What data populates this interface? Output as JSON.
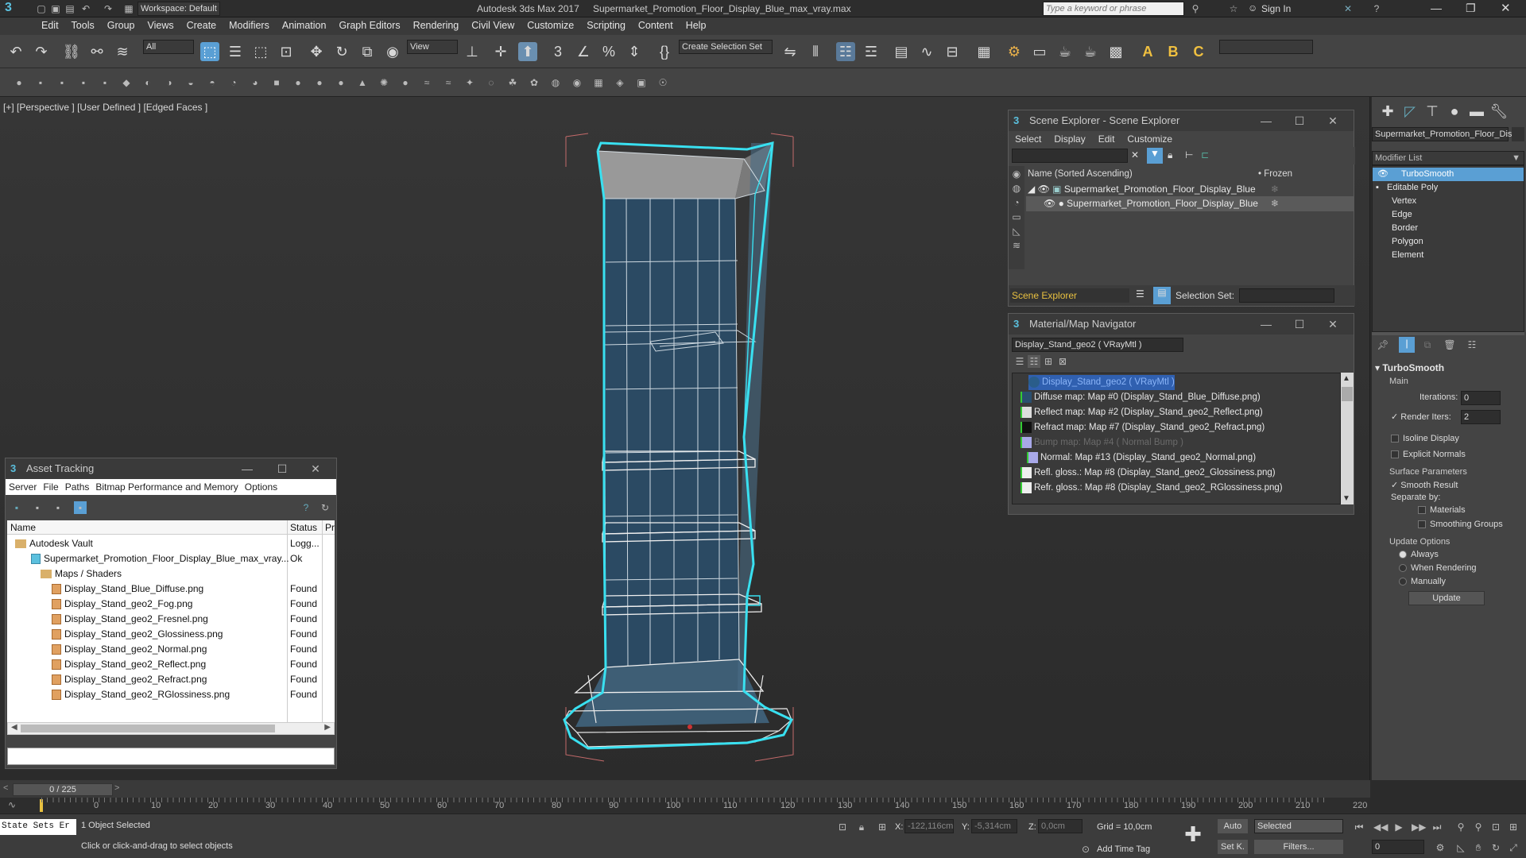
{
  "title_bar": {
    "workspace": "Workspace: Default",
    "app_title": "Autodesk 3ds Max 2017",
    "file_name": "Supermarket_Promotion_Floor_Display_Blue_max_vray.max",
    "search_placeholder": "Type a keyword or phrase",
    "sign_in": "Sign In"
  },
  "menu": [
    "Edit",
    "Tools",
    "Group",
    "Views",
    "Create",
    "Modifiers",
    "Animation",
    "Graph Editors",
    "Rendering",
    "Civil View",
    "Customize",
    "Scripting",
    "Content",
    "Help"
  ],
  "toolbar": {
    "filter": "All",
    "ref_coord": "View",
    "selection_set": "Create Selection Set"
  },
  "viewport": {
    "label_plus": "[+]",
    "label_view": "[Perspective ]",
    "label_shading": "[User Defined ]",
    "label_edges": "[Edged Faces ]"
  },
  "scene_explorer": {
    "title": "Scene Explorer - Scene Explorer",
    "menu": [
      "Select",
      "Display",
      "Edit",
      "Customize"
    ],
    "col_name": "Name (Sorted Ascending)",
    "col_frozen": "Frozen",
    "rows": [
      "Supermarket_Promotion_Floor_Display_Blue",
      "Supermarket_Promotion_Floor_Display_Blue"
    ],
    "footer_name": "Scene Explorer",
    "selection_set_label": "Selection Set:"
  },
  "material_nav": {
    "title": "Material/Map Navigator",
    "material": "Display_Stand_geo2  ( VRayMtl )",
    "items": [
      "Display_Stand_geo2  ( VRayMtl )",
      "Diffuse map: Map #0 (Display_Stand_Blue_Diffuse.png)",
      "Reflect map: Map #2 (Display_Stand_geo2_Reflect.png)",
      "Refract map: Map #7 (Display_Stand_geo2_Refract.png)",
      "Bump map: Map #4  ( Normal Bump )",
      "Normal: Map #13 (Display_Stand_geo2_Normal.png)",
      "Refl. gloss.: Map #8 (Display_Stand_geo2_Glossiness.png)",
      "Refr. gloss.: Map #8 (Display_Stand_geo2_RGlossiness.png)"
    ]
  },
  "asset_tracking": {
    "title": "Asset Tracking",
    "menu": [
      "Server",
      "File",
      "Paths",
      "Bitmap Performance and Memory",
      "Options"
    ],
    "col_name": "Name",
    "col_status": "Status",
    "col_pr": "Pr",
    "rows": [
      {
        "name": "Autodesk Vault",
        "status": "Logg..."
      },
      {
        "name": "Supermarket_Promotion_Floor_Display_Blue_max_vray...",
        "status": "Ok"
      },
      {
        "name": "Maps / Shaders",
        "status": ""
      },
      {
        "name": "Display_Stand_Blue_Diffuse.png",
        "status": "Found"
      },
      {
        "name": "Display_Stand_geo2_Fog.png",
        "status": "Found"
      },
      {
        "name": "Display_Stand_geo2_Fresnel.png",
        "status": "Found"
      },
      {
        "name": "Display_Stand_geo2_Glossiness.png",
        "status": "Found"
      },
      {
        "name": "Display_Stand_geo2_Normal.png",
        "status": "Found"
      },
      {
        "name": "Display_Stand_geo2_Reflect.png",
        "status": "Found"
      },
      {
        "name": "Display_Stand_geo2_Refract.png",
        "status": "Found"
      },
      {
        "name": "Display_Stand_geo2_RGlossiness.png",
        "status": "Found"
      }
    ]
  },
  "command_panel": {
    "object_name": "Supermarket_Promotion_Floor_Disp",
    "modifier_list": "Modifier List",
    "stack": [
      "TurboSmooth",
      "Editable Poly",
      "Vertex",
      "Edge",
      "Border",
      "Polygon",
      "Element"
    ],
    "rollout_title": "TurboSmooth",
    "main_label": "Main",
    "iterations_label": "Iterations:",
    "iterations_value": "0",
    "render_iters_label": "Render Iters:",
    "render_iters_value": "2",
    "isoline": "Isoline Display",
    "explicit_normals": "Explicit Normals",
    "surface_params": "Surface Parameters",
    "smooth_result": "Smooth Result",
    "separate_by": "Separate by:",
    "materials": "Materials",
    "smoothing_groups": "Smoothing Groups",
    "update_options": "Update Options",
    "always": "Always",
    "when_rendering": "When Rendering",
    "manually": "Manually",
    "update_btn": "Update"
  },
  "timeline": {
    "frame_counter": "0 / 225",
    "ticks": [
      "0",
      "10",
      "20",
      "30",
      "40",
      "50",
      "60",
      "70",
      "80",
      "90",
      "100",
      "110",
      "120",
      "130",
      "140",
      "150",
      "160",
      "170",
      "180",
      "190",
      "200",
      "210",
      "220"
    ]
  },
  "status_bar": {
    "script_listener": "State Sets Er",
    "selected": "1 Object Selected",
    "hint": "Click or click-and-drag to select objects",
    "x_label": "X:",
    "x_val": "-122,116cm",
    "y_label": "Y:",
    "y_val": "-5,314cm",
    "z_label": "Z:",
    "z_val": "0,0cm",
    "grid": "Grid = 10,0cm",
    "add_time_tag": "Add Time Tag",
    "auto": "Auto",
    "selected_dd": "Selected",
    "set_k": "Set K.",
    "filters": "Filters...",
    "frame_field": "0"
  }
}
